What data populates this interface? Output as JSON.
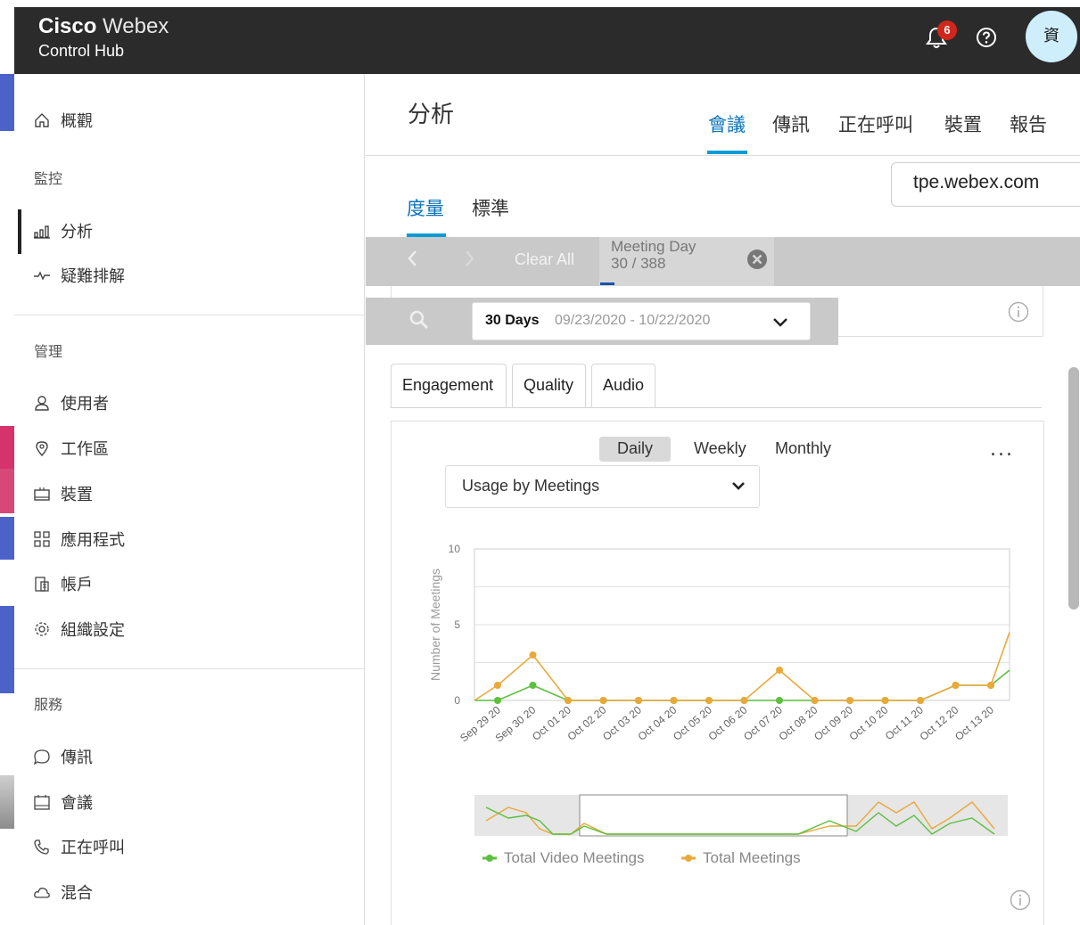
{
  "app": {
    "brand_bold": "Cisco",
    "brand_light": "Webex",
    "product": "Control Hub",
    "notifications_count": "6",
    "avatar_initial": "資"
  },
  "sidebar": {
    "overview": "概觀",
    "section_monitor": "監控",
    "analytics": "分析",
    "troubleshooting": "疑難排解",
    "section_manage": "管理",
    "users": "使用者",
    "workspaces": "工作區",
    "devices": "裝置",
    "apps": "應用程式",
    "account": "帳戶",
    "org_settings": "組織設定",
    "section_services": "服務",
    "messaging": "傳訊",
    "meetings": "會議",
    "calling": "正在呼叫",
    "hybrid": "混合"
  },
  "main": {
    "title": "分析",
    "tabs": [
      "會議",
      "傳訊",
      "正在呼叫",
      "裝置",
      "報告"
    ],
    "site": "tpe.webex.com",
    "subtabs": [
      "度量",
      "標準"
    ],
    "filter": {
      "clear_all": "Clear All",
      "chip_title": "Meeting Day",
      "chip_value": "30 / 388"
    },
    "date": {
      "range_label": "30 Days",
      "range_value": "09/23/2020 - 10/22/2020"
    },
    "view_tabs": [
      "Engagement",
      "Quality",
      "Audio"
    ],
    "periods": [
      "Daily",
      "Weekly",
      "Monthly"
    ],
    "more": "...",
    "usage_select": "Usage by Meetings"
  },
  "colors": {
    "topbar": "#2b2b2b",
    "accent": "#0a74ba",
    "video_series": "#5cbf3f",
    "total_series": "#e9a93a"
  },
  "chart_data": {
    "type": "line",
    "ylabel": "Number of Meetings",
    "ylim": [
      0,
      10
    ],
    "yticks": [
      "0",
      "5",
      "10"
    ],
    "categories": [
      "Sep 29 20",
      "Sep 30 20",
      "Oct 01 20",
      "Oct 02 20",
      "Oct 03 20",
      "Oct 04 20",
      "Oct 05 20",
      "Oct 06 20",
      "Oct 07 20",
      "Oct 08 20",
      "Oct 09 20",
      "Oct 10 20",
      "Oct 11 20",
      "Oct 12 20",
      "Oct 13 20"
    ],
    "series": [
      {
        "name": "Total Video Meetings",
        "values": [
          0,
          1,
          0,
          0,
          0,
          0,
          0,
          0,
          0,
          0,
          0,
          0,
          0,
          1,
          1
        ]
      },
      {
        "name": "Total Meetings",
        "values": [
          1,
          3,
          0,
          0,
          0,
          0,
          0,
          0,
          2,
          0,
          0,
          0,
          0,
          1,
          1
        ]
      }
    ],
    "edge_start": {
      "video": 0,
      "total": 0
    },
    "edge_end": {
      "video": 2,
      "total": 4.5
    },
    "legend": "bottom"
  }
}
